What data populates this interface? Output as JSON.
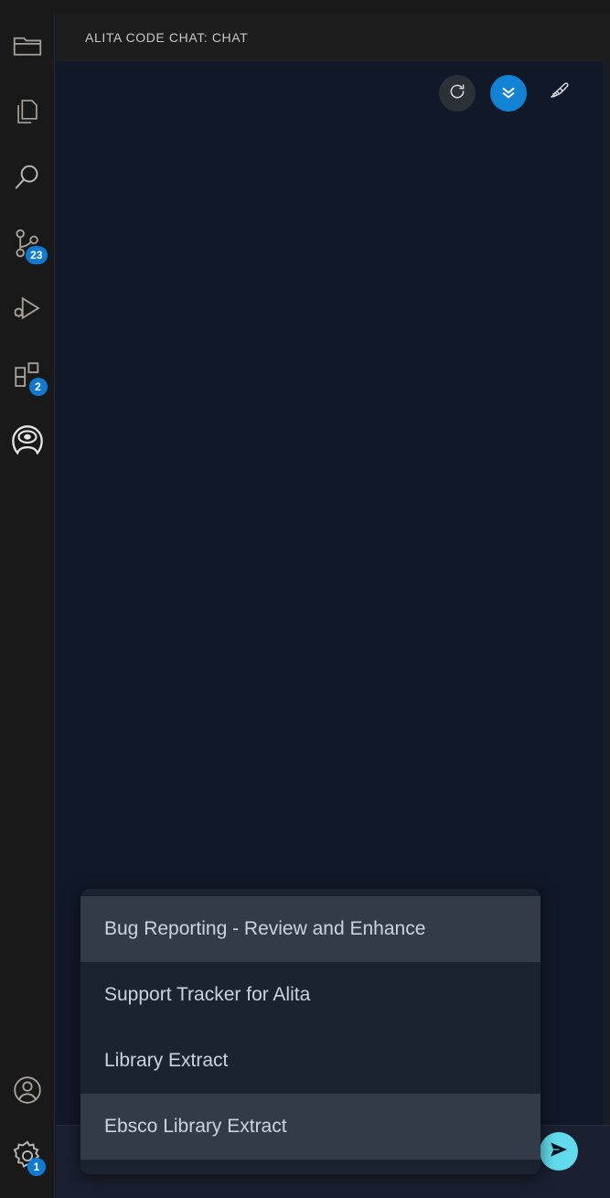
{
  "window": {
    "title_bar": ""
  },
  "activity_bar": {
    "items": [
      {
        "name": "explorer",
        "icon": "folder-icon",
        "badge": ""
      },
      {
        "name": "open-editors",
        "icon": "files-icon",
        "badge": ""
      },
      {
        "name": "search",
        "icon": "search-icon",
        "badge": ""
      },
      {
        "name": "source-control",
        "icon": "source-control-icon",
        "badge": "23"
      },
      {
        "name": "run-and-debug",
        "icon": "debug-icon",
        "badge": ""
      },
      {
        "name": "extensions",
        "icon": "extensions-icon",
        "badge": "2"
      },
      {
        "name": "alita",
        "icon": "alita-logo-icon",
        "badge": ""
      }
    ],
    "bottom_items": [
      {
        "name": "account",
        "icon": "account-icon",
        "badge": ""
      },
      {
        "name": "settings",
        "icon": "gear-icon",
        "badge": "1"
      }
    ]
  },
  "panel": {
    "header_title": "ALITA CODE CHAT: CHAT"
  },
  "toolbar": {
    "refresh_label": "refresh-icon",
    "scroll_down_label": "double-chevron-down-icon",
    "clear_label": "broom-icon"
  },
  "composer": {
    "placeholder": "",
    "value": "",
    "send_label": "send-icon"
  },
  "dropdown": {
    "items": [
      {
        "label": "Bug Reporting - Review and Enhance",
        "highlighted": true
      },
      {
        "label": "Support Tracker for Alita",
        "highlighted": false
      },
      {
        "label": "Library Extract",
        "highlighted": false
      },
      {
        "label": "Ebsco Library Extract",
        "highlighted": true
      }
    ]
  },
  "colors": {
    "accent_blue": "#1282d4",
    "badge_blue": "#0e7ad1",
    "send_cyan": "#62dcec",
    "chat_bg": "#111827",
    "activity_bg": "#191919",
    "dropdown_bg": "#1b2230",
    "dropdown_highlight": "#333b48"
  }
}
